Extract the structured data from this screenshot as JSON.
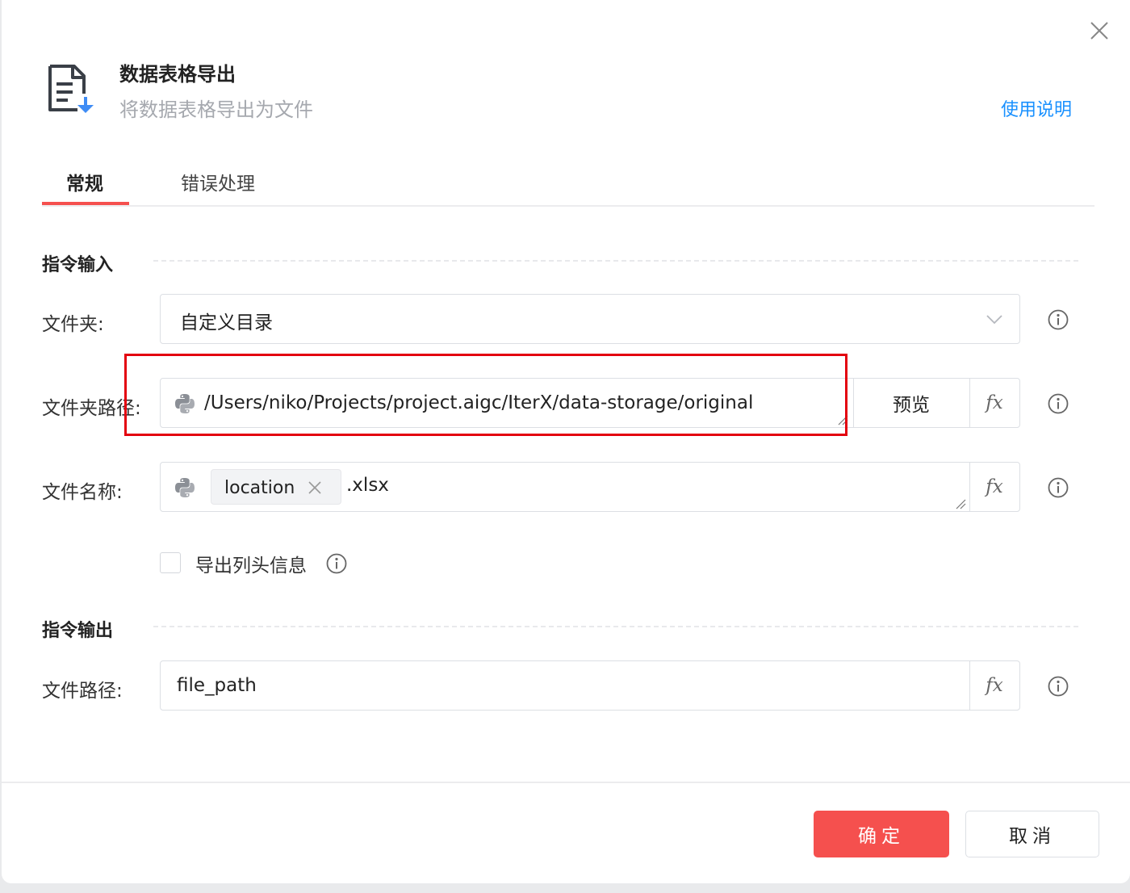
{
  "dialog": {
    "title": "数据表格导出",
    "subtitle": "将数据表格导出为文件",
    "help_link": "使用说明",
    "close_icon": "close-icon",
    "header_icon": "file-export-icon"
  },
  "tabs": [
    {
      "label": "常规",
      "active": true
    },
    {
      "label": "错误处理",
      "active": false
    }
  ],
  "sections": {
    "input_title": "指令输入",
    "output_title": "指令输出"
  },
  "form": {
    "folder": {
      "label": "文件夹:",
      "value": "自定义目录"
    },
    "folder_path": {
      "label": "文件夹路径:",
      "value": "/Users/niko/Projects/project.aigc/IterX/data-storage/original",
      "preview_label": "预览",
      "fx_label": "fx"
    },
    "file_name": {
      "label": "文件名称:",
      "tag": "location",
      "suffix": ".xlsx",
      "fx_label": "fx"
    },
    "export_header": {
      "label": "导出列头信息",
      "checked": false
    },
    "file_path": {
      "label": "文件路径:",
      "value": "file_path",
      "fx_label": "fx"
    }
  },
  "buttons": {
    "ok": "确定",
    "cancel": "取消"
  },
  "colors": {
    "accent": "#f5504e",
    "link": "#1890ff",
    "highlight": "#e3000f"
  }
}
